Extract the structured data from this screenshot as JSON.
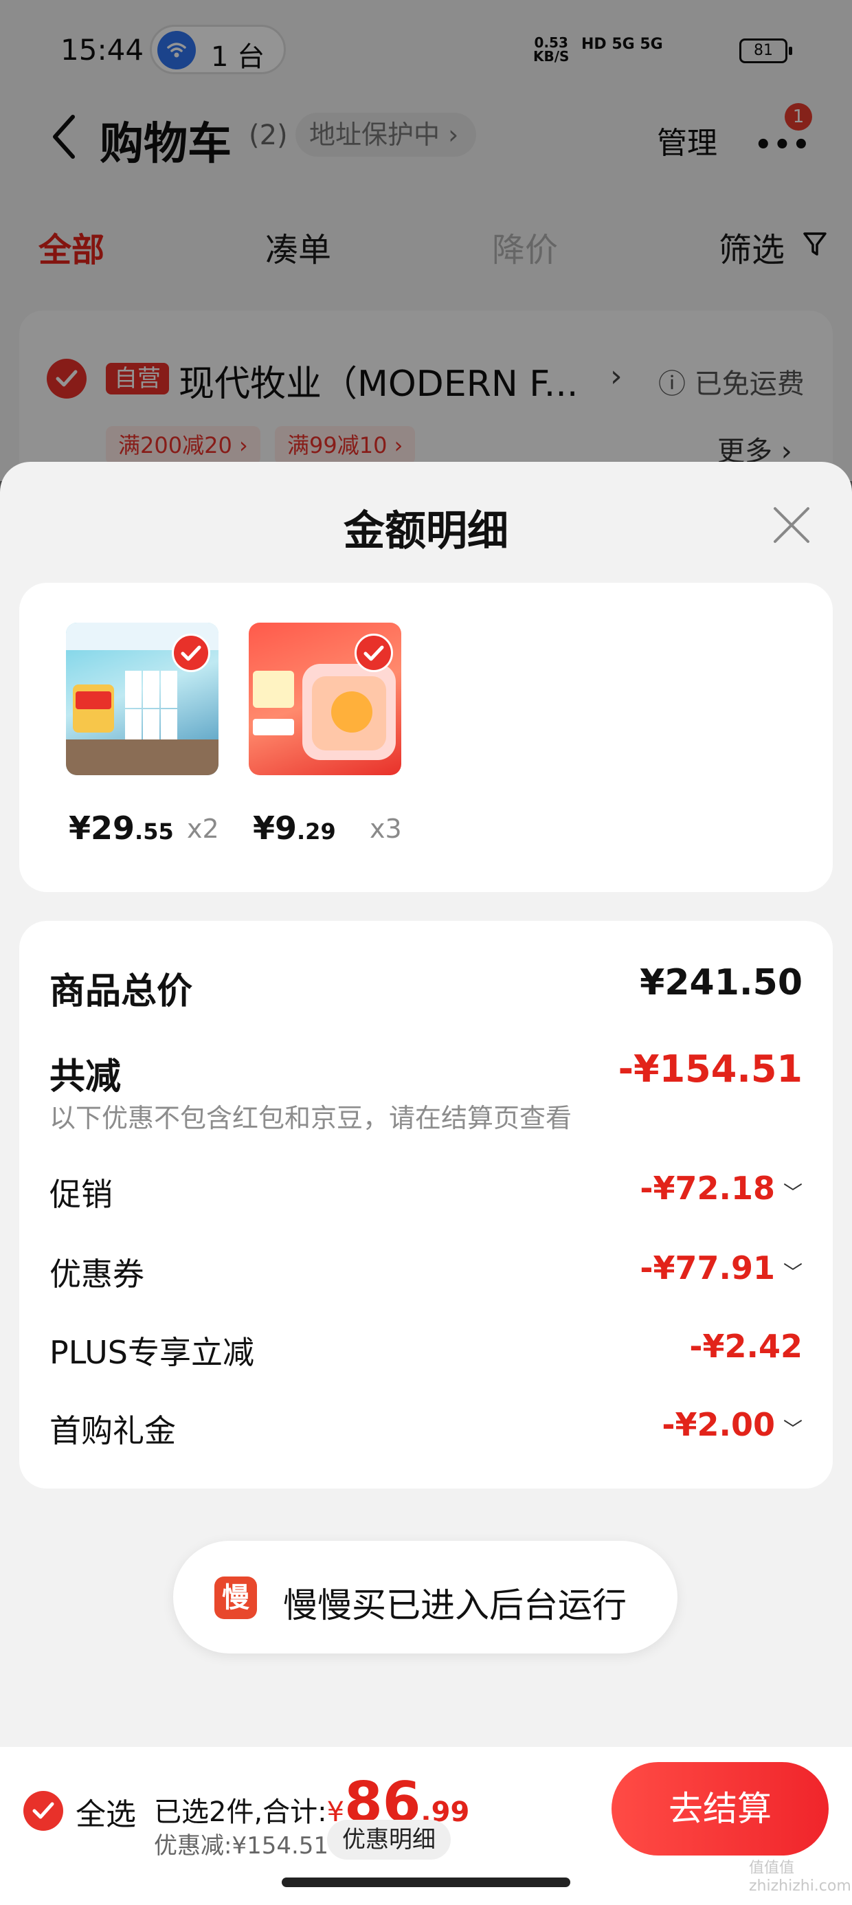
{
  "status_bar": {
    "time": "15:44",
    "hotspot": "1 台",
    "net_speed_value": "0.53",
    "net_speed_unit": "KB/S",
    "signals": "HD 5G 5G",
    "battery": "81"
  },
  "nav": {
    "title": "购物车",
    "count": "(2)",
    "address_protect": "地址保护中 ›",
    "manage": "管理",
    "more_badge": "1"
  },
  "tabs": [
    {
      "label": "全部"
    },
    {
      "label": "凑单"
    },
    {
      "label": "降价"
    },
    {
      "label": "筛选"
    }
  ],
  "shop": {
    "tag": "自营",
    "name": "现代牧业（MODERN F...",
    "free_shipping": "ⓘ 已免运费",
    "promos": [
      "满200减20 ›",
      "满99减10 ›"
    ],
    "more": "更多 ›"
  },
  "sheet": {
    "title": "金额明细",
    "items": [
      {
        "price_int": "¥29",
        "price_dec": ".55",
        "qty": "x2"
      },
      {
        "price_int": "¥9",
        "price_dec": ".29",
        "qty": "x3"
      }
    ],
    "total_label": "商品总价",
    "total_value": "¥241.50",
    "reduce_label": "共减",
    "reduce_value": "-¥154.51",
    "reduce_note": "以下优惠不包含红包和京豆，请在结算页查看",
    "rows": [
      {
        "label": "促销",
        "value": "-¥72.18"
      },
      {
        "label": "优惠券",
        "value": "-¥77.91"
      },
      {
        "label": "PLUS专享立减",
        "value": "-¥2.42"
      },
      {
        "label": "首购礼金",
        "value": "-¥2.00"
      }
    ]
  },
  "toast": {
    "icon_char": "慢",
    "text": "慢慢买已进入后台运行"
  },
  "bottom": {
    "select_all": "全选",
    "summary_prefix": "已选2件,合计:",
    "yen": "¥",
    "total_int": "86",
    "total_dec": ".99",
    "discount": "优惠减:¥154.51",
    "detail_btn": "优惠明细",
    "checkout": "去结算"
  },
  "watermark": "值值值 zhizhizhi.com",
  "colors": {
    "accent": "#e2231a",
    "checkout_start": "#ff4b45",
    "checkout_end": "#f0252b"
  }
}
